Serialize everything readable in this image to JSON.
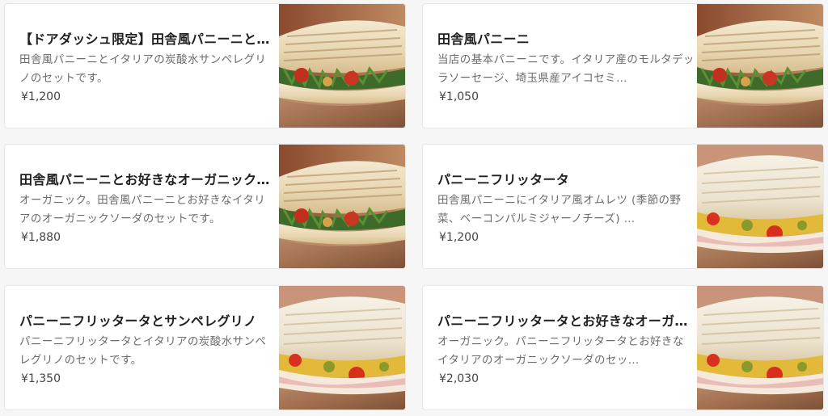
{
  "colors": {
    "page_background": "#f6f6f6",
    "card_background": "#ffffff",
    "title_text": "#1f1f1f",
    "description_text": "#6b6b6b",
    "price_text": "#444444"
  },
  "menu_items": [
    {
      "title": "【ドアダッシュ限定】田舎風パニーニとサンペレグリノのセット",
      "description": "田舎風パニーニとイタリアの炭酸水サンペレグリノのセットです。",
      "price": "¥1,200",
      "photo": "rustic-panini-photo"
    },
    {
      "title": "田舎風パニーニ",
      "description": "当店の基本パニーニです。イタリア産のモルタデッラソーセージ、埼玉県産アイコセミ…",
      "price": "¥1,050",
      "photo": "rustic-panini-photo"
    },
    {
      "title": "田舎風パニーニとお好きなオーガニックソーダ",
      "description": "オーガニック。田舎風パニーニとお好きなイタリアのオーガニックソーダのセットです。",
      "price": "¥1,880",
      "photo": "rustic-panini-photo"
    },
    {
      "title": "パニーニフリッタータ",
      "description": "田舎風パニーニにイタリア風オムレツ (季節の野菜、ベーコンパルミジャーノチーズ) …",
      "price": "¥1,200",
      "photo": "frittata-panini-photo"
    },
    {
      "title": "パニーニフリッタータとサンペレグリノ",
      "description": "パニーニフリッタータとイタリアの炭酸水サンペレグリノのセットです。",
      "price": "¥1,350",
      "photo": "frittata-panini-photo"
    },
    {
      "title": "パニーニフリッタータとお好きなオーガニックソーダ",
      "description": "オーガニック。パニーニフリッタータとお好きなイタリアのオーガニックソーダのセッ…",
      "price": "¥2,030",
      "photo": "frittata-panini-photo"
    }
  ]
}
